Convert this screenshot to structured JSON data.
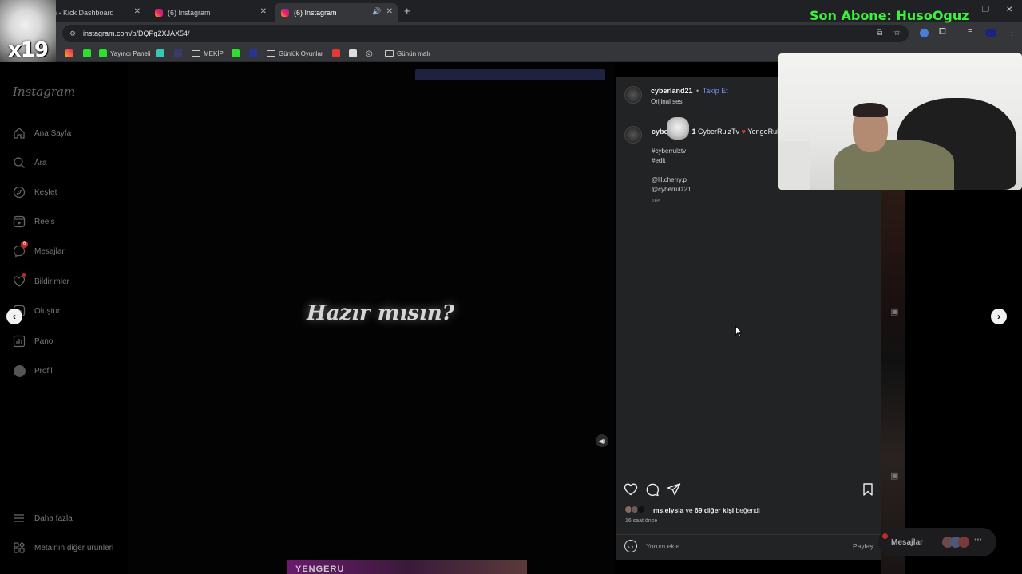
{
  "browser": {
    "tabs": [
      {
        "label": "n - Kick Dashboard"
      },
      {
        "label": "(6) Instagram"
      },
      {
        "label": "(6) Instagram"
      }
    ],
    "url": "instagram.com/p/DQPg2XJAX54/",
    "bookmarks": [
      {
        "label": "Yayıncı Paneli"
      },
      {
        "label": "MEKİP"
      },
      {
        "label": "Günlük Oyunlar"
      },
      {
        "label": "Günün malı"
      }
    ]
  },
  "overlay": {
    "badge": "x19",
    "subscriber_banner": "Son Abone: HusoOguz"
  },
  "nav": {
    "logo": "Instagram",
    "items": [
      {
        "label": "Ana Sayfa",
        "icon": "home-icon"
      },
      {
        "label": "Ara",
        "icon": "search-icon"
      },
      {
        "label": "Keşfet",
        "icon": "compass-icon"
      },
      {
        "label": "Reels",
        "icon": "reels-icon"
      },
      {
        "label": "Mesajlar",
        "icon": "messenger-icon",
        "badge": "6"
      },
      {
        "label": "Bildirimler",
        "icon": "heart-icon"
      },
      {
        "label": "Oluştur",
        "icon": "plus-icon"
      },
      {
        "label": "Pano",
        "icon": "chart-icon"
      },
      {
        "label": "Profil",
        "icon": "avatar-icon"
      }
    ],
    "more": "Daha fazla",
    "meta": "Meta'nın diğer ürünleri"
  },
  "video": {
    "caption": "Hazır mısın?",
    "bottom_thumb_text": "YENGERU"
  },
  "post": {
    "username": "cyberland21",
    "separator": "•",
    "follow": "Takip Et",
    "audio": "Orijinal ses",
    "caption_user": "cybe",
    "caption_user_suffix": "1",
    "caption_text": "CyberRulzTv",
    "caption_tail": "YengeRul",
    "hashtags": [
      "#cyberrulztv",
      "#edit"
    ],
    "mentions": [
      "@lil.cherry.p",
      "@cyberrulz21"
    ],
    "time_short": "16s",
    "likes_user": "ms.elysia",
    "likes_text_mid": "ve",
    "likes_count": "69 diğer kişi",
    "likes_text_end": "beğendi",
    "time_long": "16 saat önce",
    "comment_placeholder": "Yorum ekle...",
    "share": "Paylaş"
  },
  "messages_pill": "Mesajlar"
}
